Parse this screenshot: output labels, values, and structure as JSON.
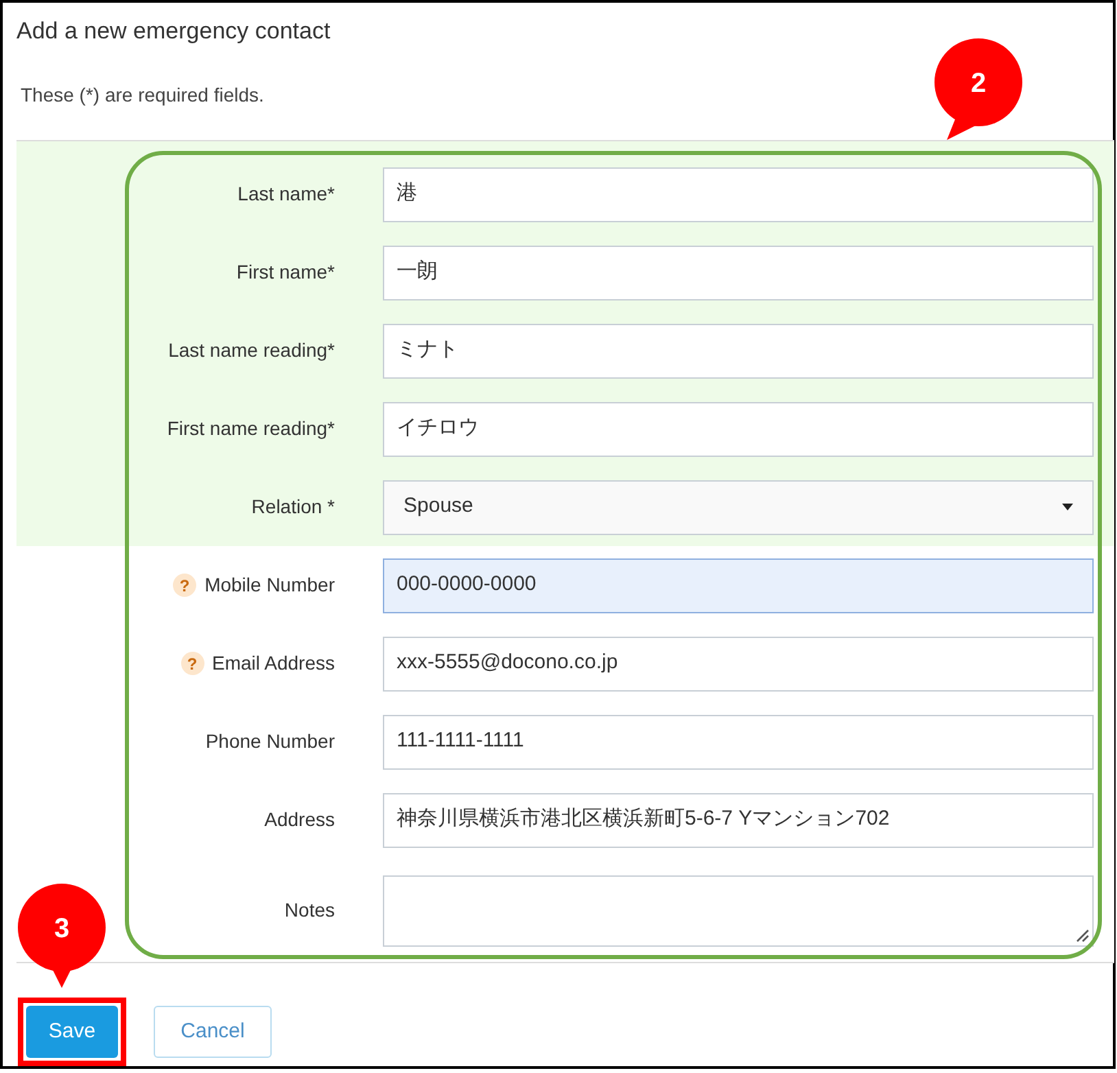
{
  "title": "Add a new emergency contact",
  "note": "These (*) are required fields.",
  "fields": [
    {
      "label": "Last name*",
      "kind": "text",
      "value": "港",
      "required": true,
      "focused": false
    },
    {
      "label": "First name*",
      "kind": "text",
      "value": "一朗",
      "required": true,
      "focused": false
    },
    {
      "label": "Last name reading*",
      "kind": "text",
      "value": "ミナト",
      "required": true,
      "focused": false
    },
    {
      "label": "First name reading*",
      "kind": "text",
      "value": "イチロウ",
      "required": true,
      "focused": false
    },
    {
      "label": "Relation *",
      "kind": "select",
      "value": "Spouse",
      "required": true,
      "focused": false
    },
    {
      "label": "Mobile Number",
      "kind": "text",
      "value": "000-0000-0000",
      "required": false,
      "focused": true,
      "help": "?"
    },
    {
      "label": "Email Address",
      "kind": "text",
      "value": "xxx-5555@docono.co.jp",
      "required": false,
      "focused": false,
      "help": "?"
    },
    {
      "label": "Phone Number",
      "kind": "text",
      "value": "111-1111-1111",
      "required": false,
      "focused": false
    },
    {
      "label": "Address",
      "kind": "text",
      "value": "神奈川県横浜市港北区横浜新町5-6-7 Yマンション702",
      "required": false,
      "focused": false
    },
    {
      "label": "Notes",
      "kind": "textarea",
      "required": false,
      "focused": false
    }
  ],
  "buttons": [
    {
      "label": "Save",
      "kind": "primary",
      "highlighted": true
    },
    {
      "label": "Cancel",
      "kind": "secondary",
      "highlighted": false
    }
  ],
  "callouts": [
    {
      "label": "2"
    },
    {
      "label": "3"
    }
  ]
}
